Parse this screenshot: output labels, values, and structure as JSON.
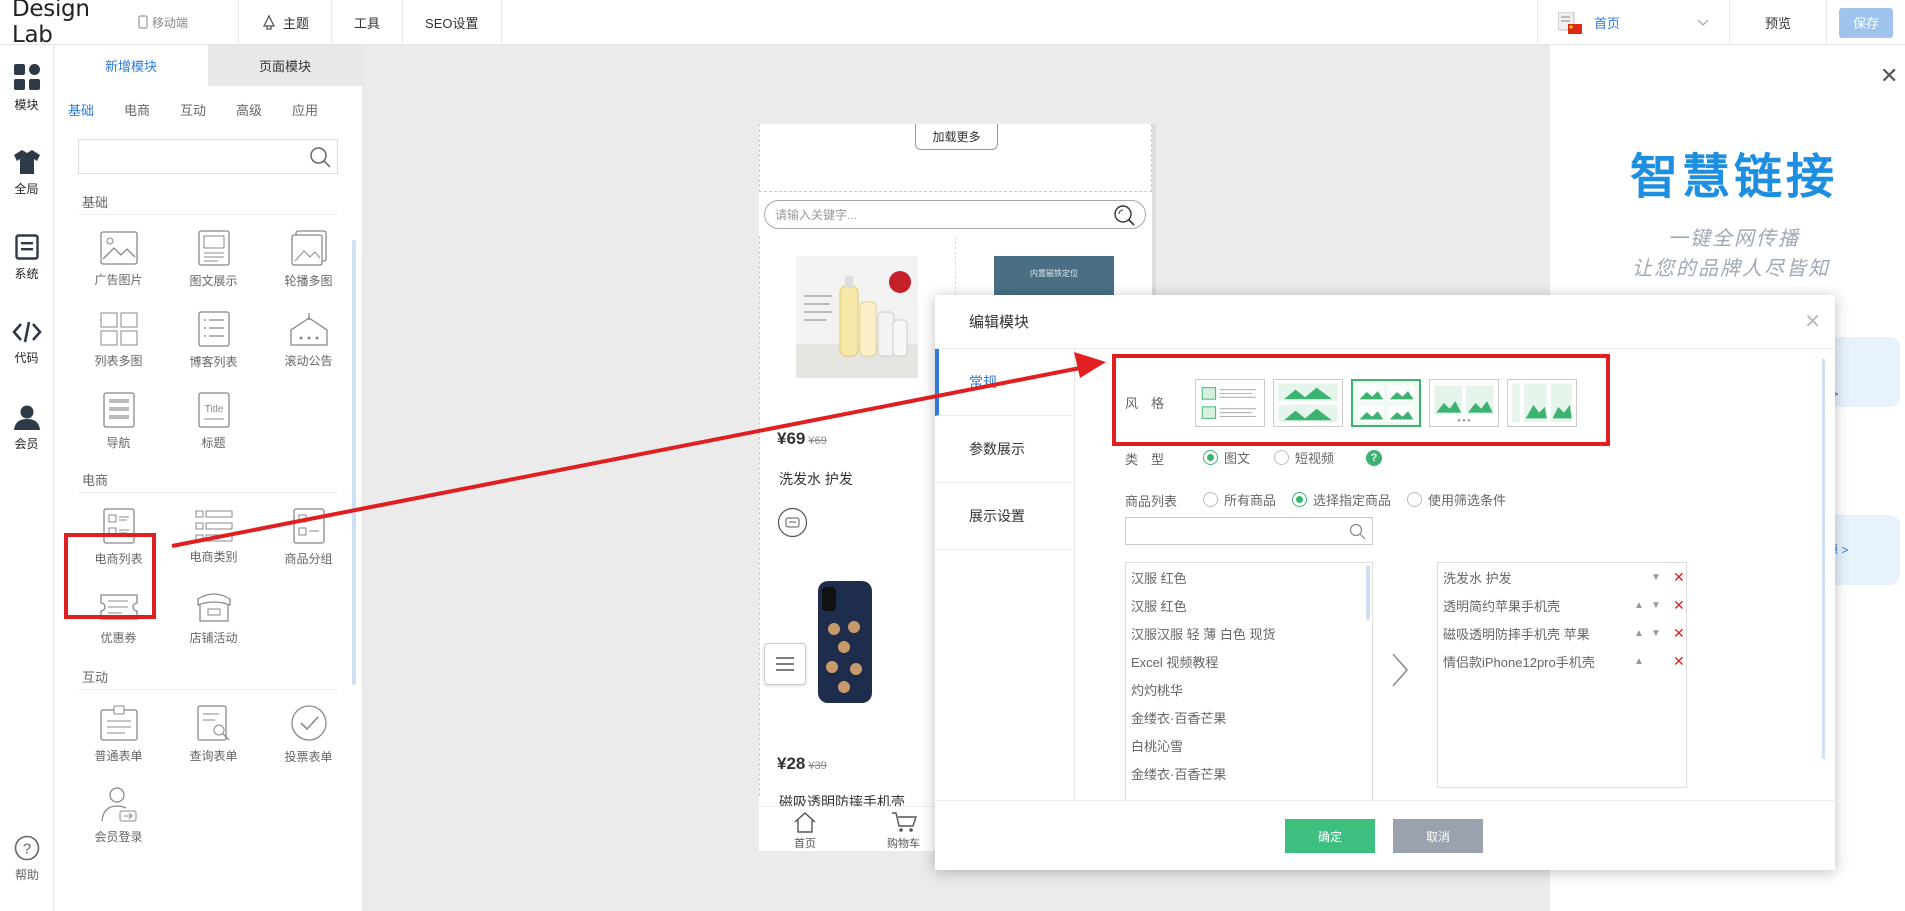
{
  "app": {
    "title": "Design Lab",
    "mobile_label": "移动端"
  },
  "topnav": [
    {
      "label": "主题",
      "icon": "theme-icon"
    },
    {
      "label": "工具"
    },
    {
      "label": "SEO设置"
    }
  ],
  "topright": {
    "page_label": "首页",
    "preview": "预览",
    "save": "保存"
  },
  "rail": [
    {
      "label": "模块",
      "icon": "modules-icon"
    },
    {
      "label": "全局",
      "icon": "shirt-icon"
    },
    {
      "label": "系统",
      "icon": "document-icon"
    },
    {
      "label": "代码",
      "icon": "code-icon"
    },
    {
      "label": "会员",
      "icon": "user-icon"
    }
  ],
  "rail_help": "帮助",
  "panel": {
    "tabs": [
      "新增模块",
      "页面模块"
    ],
    "categories": [
      "基础",
      "电商",
      "互动",
      "高级",
      "应用"
    ],
    "sections": [
      {
        "title": "基础",
        "items": [
          "广告图片",
          "图文展示",
          "轮播多图",
          "列表多图",
          "博客列表",
          "滚动公告",
          "导航",
          "标题"
        ]
      },
      {
        "title": "电商",
        "items": [
          "电商列表",
          "电商类别",
          "商品分组",
          "优惠券",
          "店铺活动"
        ]
      },
      {
        "title": "互动",
        "items": [
          "普通表单",
          "查询表单",
          "投票表单",
          "会员登录"
        ]
      }
    ]
  },
  "phone": {
    "load_more": "加载更多",
    "search_placeholder": "请输入关键字...",
    "products": [
      {
        "price": "¥69",
        "old_price": "¥69",
        "name": "洗发水 护发"
      },
      {
        "price": "¥28",
        "old_price": "¥39",
        "name": "磁吸透明防摔手机壳"
      }
    ],
    "img2_text": "内置磁铁定位",
    "tabs": [
      "首页",
      "购物车"
    ]
  },
  "promo": {
    "headline": "智慧链接",
    "line1": "一键全网传播",
    "line2": "让您的品牌人尽皆知",
    "edge1": "本 >",
    "edge2": "资源 >"
  },
  "dialog": {
    "title": "编辑模块",
    "nav": [
      "常规",
      "参数展示",
      "展示设置"
    ],
    "style_label": "风　格",
    "type_label": "类　型",
    "type_options": [
      "图文",
      "短视频"
    ],
    "list_label": "商品列表",
    "list_options": [
      "所有商品",
      "选择指定商品",
      "使用筛选条件"
    ],
    "left_items": [
      "汉服 红色",
      "汉服 红色",
      "汉服汉服 轻 薄 白色 现货",
      "Excel 视频教程",
      "灼灼桃华",
      "金缕衣·百香芒果",
      "白桃沁雪",
      "金缕衣·百香芒果"
    ],
    "right_items": [
      "洗发水 护发",
      "透明简约苹果手机壳",
      "磁吸透明防摔手机壳 苹果",
      "情侣款iPhone12pro手机壳"
    ],
    "ok": "确定",
    "cancel": "取消"
  },
  "colors": {
    "accent": "#2d7bd8",
    "green": "#3cb371",
    "annotation": "#e02020"
  }
}
